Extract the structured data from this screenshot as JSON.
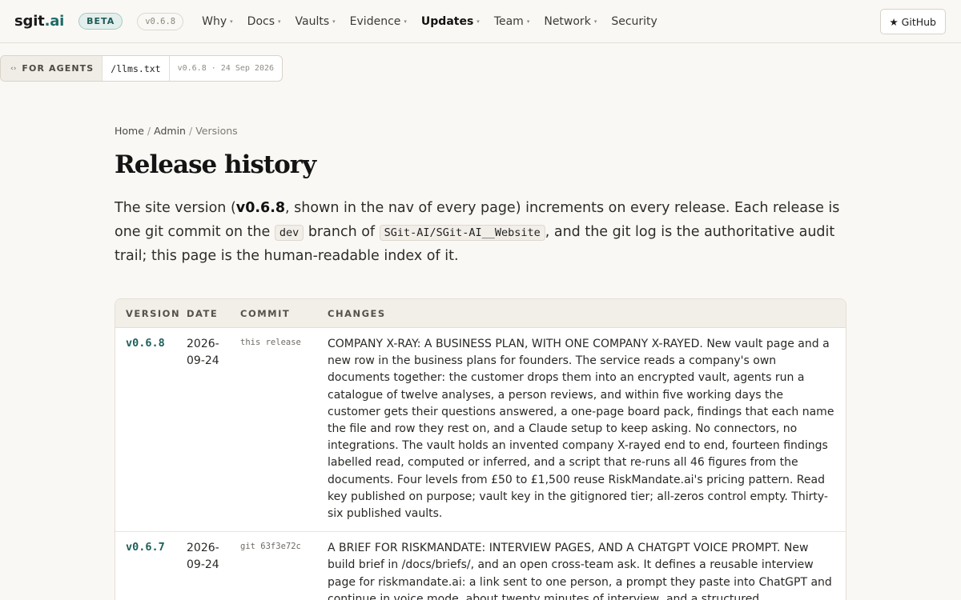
{
  "brand": {
    "name": "sgit",
    "suffix": ".ai",
    "badge": "BETA",
    "version": "v0.6.8"
  },
  "nav": {
    "items": [
      {
        "label": "Why",
        "caret": "▾"
      },
      {
        "label": "Docs",
        "caret": "▾"
      },
      {
        "label": "Vaults",
        "caret": "▾"
      },
      {
        "label": "Evidence",
        "caret": "▾"
      },
      {
        "label": "Updates",
        "caret": "▾",
        "active": true
      },
      {
        "label": "Team",
        "caret": "▾"
      },
      {
        "label": "Network",
        "caret": "▾"
      },
      {
        "label": "Security",
        "caret": ""
      }
    ],
    "github_label": "★ GitHub"
  },
  "agents": {
    "icon": "‹›",
    "label": "FOR AGENTS",
    "link": "/llms.txt",
    "stamp": "v0.6.8 · 24 Sep 2026"
  },
  "breadcrumb": {
    "home": "Home",
    "admin": "Admin",
    "current": "Versions",
    "sep": "/"
  },
  "page": {
    "title": "Release history",
    "intro": {
      "p1": "The site version (",
      "version": "v0.6.8",
      "p2": ", shown in the nav of every page) increments on every release. Each release is one git commit on the ",
      "branch": "dev",
      "p3": " branch of ",
      "repo": "SGit-AI/SGit-AI__Website",
      "p4": ", and the git log is the authoritative audit trail; this page is the human-readable index of it."
    }
  },
  "table": {
    "headers": {
      "version": "VERSION",
      "date": "DATE",
      "commit": "COMMIT",
      "changes": "CHANGES"
    },
    "rows": [
      {
        "version": "v0.6.8",
        "date": "2026-\n09-24",
        "commit": "this release",
        "changes": "COMPANY X-RAY: A BUSINESS PLAN, WITH ONE COMPANY X-RAYED. New vault page and a new row in the business plans for founders. The service reads a company's own documents together: the customer drops them into an encrypted vault, agents run a catalogue of twelve analyses, a person reviews, and within five working days the customer gets their questions answered, a one-page board pack, findings that each name the file and row they rest on, and a Claude setup to keep asking. No connectors, no integrations. The vault holds an invented company X-rayed end to end, fourteen findings labelled read, computed or inferred, and a script that re-runs all 46 figures from the documents. Four levels from £50 to £1,500 reuse RiskMandate.ai's pricing pattern. Read key published on purpose; vault key in the gitignored tier; all-zeros control empty. Thirty-six published vaults."
      },
      {
        "version": "v0.6.7",
        "date": "2026-\n09-24",
        "commit": "git 63f3e72c",
        "changes": "A BRIEF FOR RISKMANDATE: INTERVIEW PAGES, AND A CHATGPT VOICE PROMPT. New build brief in /docs/briefs/, and an open cross-team ask. It defines a reusable interview page for riskmandate.ai: a link sent to one person, a prompt they paste into ChatGPT and continue in voice mode, about twenty minutes of interview, and a structured"
      }
    ]
  }
}
